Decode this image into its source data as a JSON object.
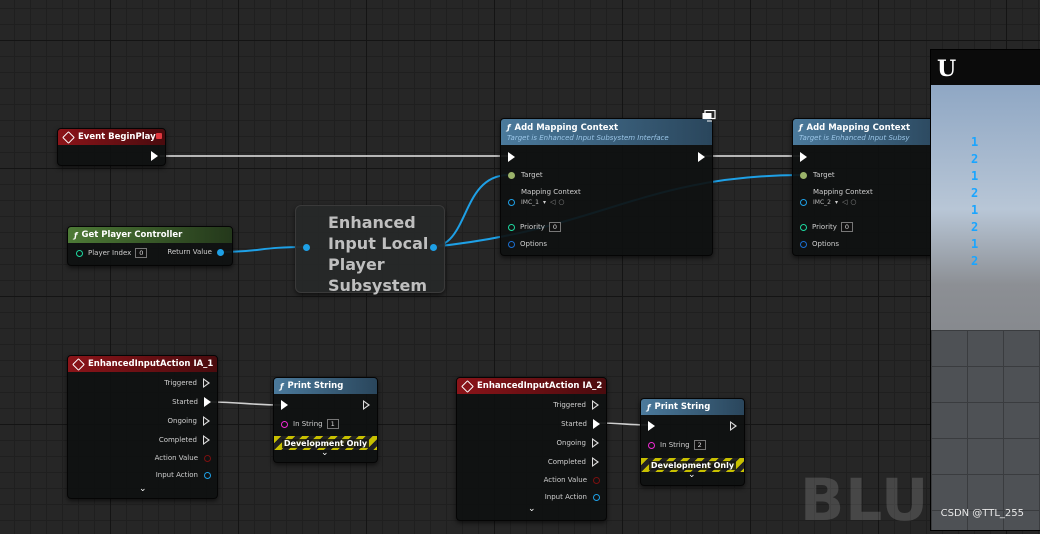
{
  "nodes": {
    "event_begin_play": {
      "title": "Event BeginPlay"
    },
    "get_player_controller": {
      "title": "Get Player Controller",
      "player_index_label": "Player Index",
      "player_index_value": "0",
      "return_value_label": "Return Value"
    },
    "subsystem": {
      "title_lines": [
        "Enhanced",
        "Input Local",
        "Player",
        "Subsystem"
      ]
    },
    "add_mapping_context_1": {
      "title": "Add Mapping Context",
      "subtitle": "Target is Enhanced Input Subsystem Interface",
      "target_label": "Target",
      "mapping_label": "Mapping Context",
      "mapping_value": "IMC_1",
      "priority_label": "Priority",
      "priority_value": "0",
      "options_label": "Options"
    },
    "add_mapping_context_2": {
      "title": "Add Mapping Context",
      "subtitle": "Target is Enhanced Input Subsy",
      "target_label": "Target",
      "mapping_label": "Mapping Context",
      "mapping_value": "IMC_2",
      "priority_label": "Priority",
      "priority_value": "0",
      "options_label": "Options"
    },
    "ia_1": {
      "title": "EnhancedInputAction IA_1",
      "pins": [
        "Triggered",
        "Started",
        "Ongoing",
        "Completed",
        "Action Value",
        "Input Action"
      ]
    },
    "ia_2": {
      "title": "EnhancedInputAction IA_2",
      "pins": [
        "Triggered",
        "Started",
        "Ongoing",
        "Completed",
        "Action Value",
        "Input Action"
      ]
    },
    "print_1": {
      "title": "Print String",
      "in_string_label": "In String",
      "in_string_value": "1",
      "dev_only": "Development Only"
    },
    "print_2": {
      "title": "Print String",
      "in_string_label": "In String",
      "in_string_value": "2",
      "dev_only": "Development Only"
    }
  },
  "viewport": {
    "logo": "U",
    "output_lines": [
      "1",
      "2",
      "1",
      "2",
      "1",
      "2",
      "1",
      "2"
    ]
  },
  "watermark": "BLUE",
  "credit": "CSDN @TTL_255",
  "colors": {
    "exec": "#ffffff",
    "object_wire": "#1ea0e6",
    "struct_pin": "#1b6fd1",
    "string_pin": "#f02ad4",
    "int_pin": "#1ed9a0",
    "event_header": "#8b1419",
    "pure_header": "#4d7a36",
    "func_header": "#4b7a9c"
  }
}
